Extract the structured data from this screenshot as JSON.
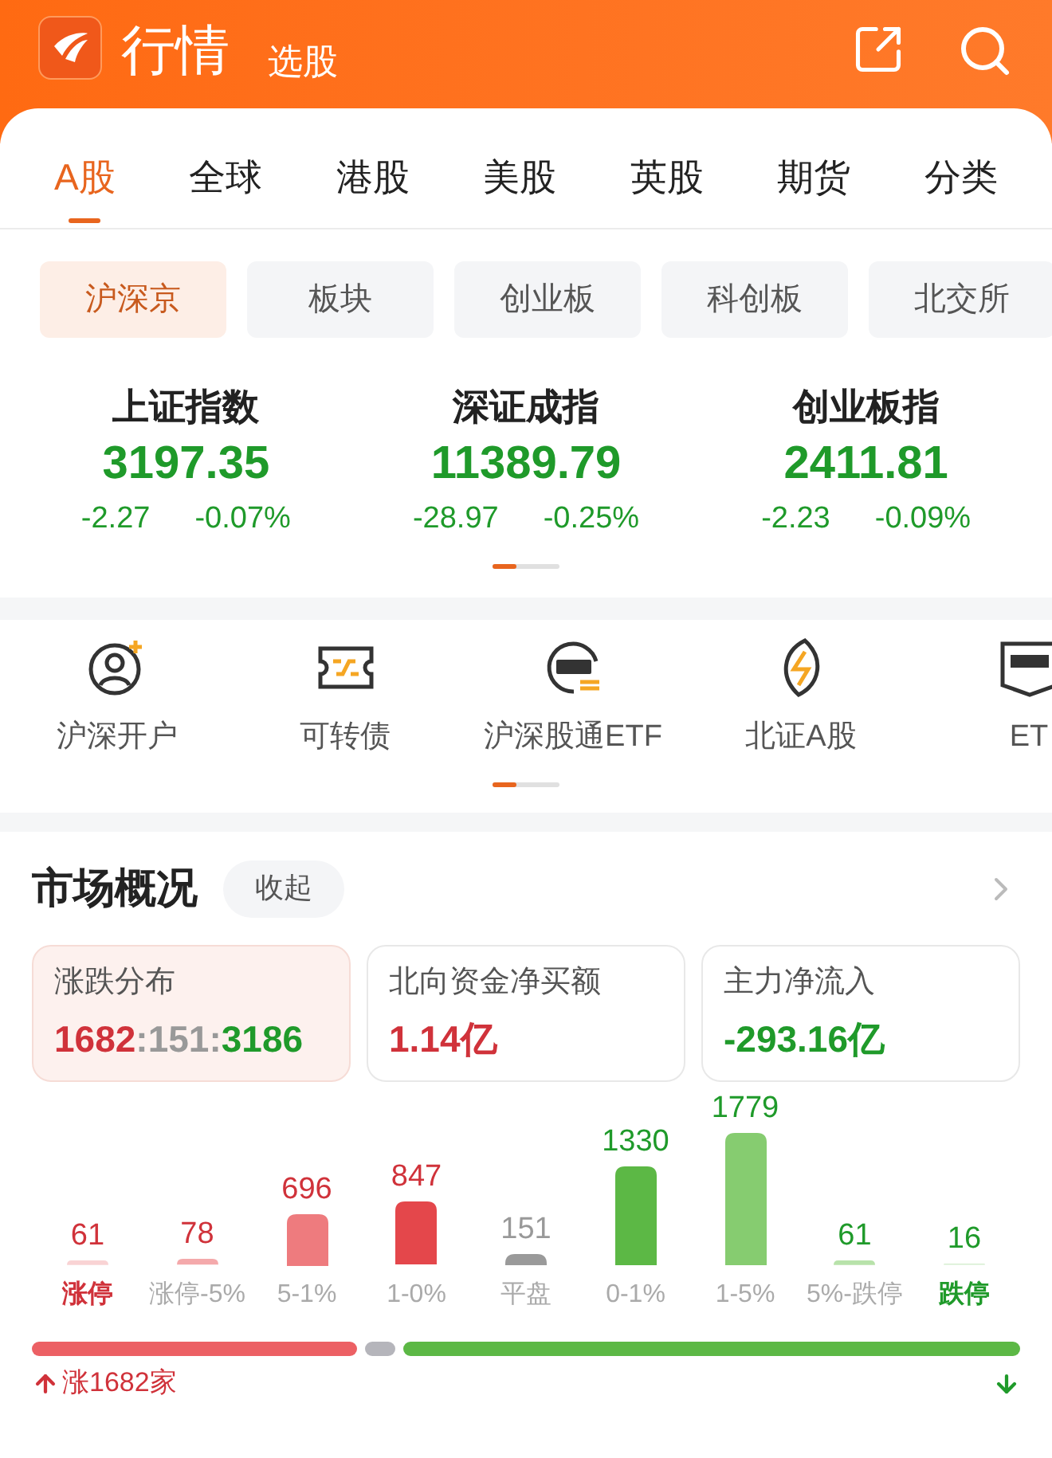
{
  "header": {
    "title": "行情",
    "subtitle": "选股"
  },
  "tabs": [
    {
      "label": "A股",
      "selected": true
    },
    {
      "label": "全球",
      "selected": false
    },
    {
      "label": "港股",
      "selected": false
    },
    {
      "label": "美股",
      "selected": false
    },
    {
      "label": "英股",
      "selected": false
    },
    {
      "label": "期货",
      "selected": false
    },
    {
      "label": "分类",
      "selected": false
    }
  ],
  "chips": [
    {
      "label": "沪深京",
      "selected": true
    },
    {
      "label": "板块",
      "selected": false
    },
    {
      "label": "创业板",
      "selected": false
    },
    {
      "label": "科创板",
      "selected": false
    },
    {
      "label": "北交所",
      "selected": false
    }
  ],
  "indices": [
    {
      "name": "上证指数",
      "value": "3197.35",
      "change": "-2.27",
      "percent": "-0.07%"
    },
    {
      "name": "深证成指",
      "value": "11389.79",
      "change": "-28.97",
      "percent": "-0.25%"
    },
    {
      "name": "创业板指",
      "value": "2411.81",
      "change": "-2.23",
      "percent": "-0.09%"
    }
  ],
  "shortcuts": [
    {
      "kind": "account",
      "label": "沪深开户"
    },
    {
      "kind": "bond",
      "label": "可转债"
    },
    {
      "kind": "etf",
      "label": "沪深股通ETF"
    },
    {
      "kind": "bse",
      "label": "北证A股"
    },
    {
      "kind": "etf-box",
      "label": "ET"
    }
  ],
  "market": {
    "title": "市场概况",
    "collapse": "收起",
    "cards": [
      {
        "label": "涨跌分布",
        "selected": true,
        "parts": [
          {
            "text": "1682",
            "color": "#d0323a"
          },
          {
            "text": ":",
            "color": "#999999"
          },
          {
            "text": "151",
            "color": "#999999"
          },
          {
            "text": ":",
            "color": "#999999"
          },
          {
            "text": "3186",
            "color": "#1f9a2a"
          }
        ]
      },
      {
        "label": "北向资金净买额",
        "selected": false,
        "parts": [
          {
            "text": "1.14亿",
            "color": "#d0323a"
          }
        ]
      },
      {
        "label": "主力净流入",
        "selected": false,
        "parts": [
          {
            "text": "-293.16亿",
            "color": "#1f9a2a"
          }
        ]
      }
    ],
    "distribution": {
      "chart_data": {
        "type": "bar",
        "categories": [
          "涨停",
          "涨停-5%",
          "5-1%",
          "1-0%",
          "平盘",
          "0-1%",
          "1-5%",
          "5%-跌停",
          "跌停"
        ],
        "values": [
          61,
          78,
          696,
          847,
          151,
          1330,
          1779,
          61,
          16
        ],
        "data_labels": true
      },
      "bars": [
        {
          "color": "#f9d3d4",
          "kind": "up",
          "strong": true
        },
        {
          "color": "#f4a9ab",
          "kind": "up",
          "strong": false
        },
        {
          "color": "#ee7b7e",
          "kind": "up",
          "strong": false
        },
        {
          "color": "#e4474b",
          "kind": "up",
          "strong": false
        },
        {
          "color": "#9a9a9a",
          "kind": "flat",
          "strong": false
        },
        {
          "color": "#5cb845",
          "kind": "down",
          "strong": false
        },
        {
          "color": "#86cc70",
          "kind": "down",
          "strong": false
        },
        {
          "color": "#b8e2aa",
          "kind": "down",
          "strong": false
        },
        {
          "color": "#d6eed0",
          "kind": "down",
          "strong": true
        }
      ]
    },
    "up_count": "涨1682家"
  }
}
